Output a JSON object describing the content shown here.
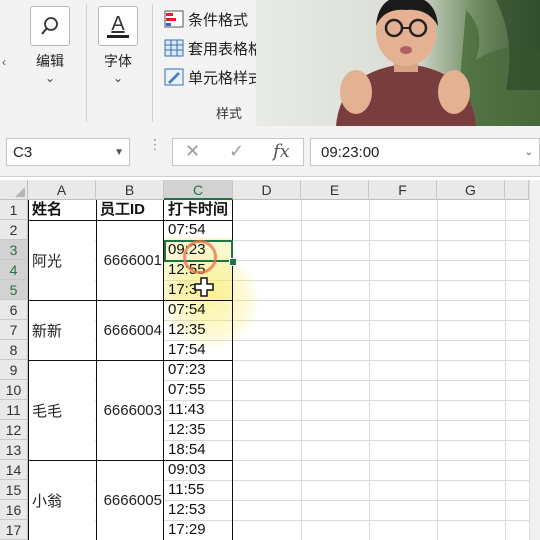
{
  "ribbon": {
    "buttons": [
      {
        "label": "编辑",
        "icon": "search-icon"
      },
      {
        "label": "字体",
        "icon": "font-color-icon"
      }
    ],
    "styles": {
      "items": [
        {
          "label": "条件格式",
          "icon": "conditional-format-icon"
        },
        {
          "label": "套用表格格式",
          "icon": "format-as-table-icon"
        },
        {
          "label": "单元格样式",
          "icon": "cell-styles-icon"
        }
      ],
      "group_label": "样式"
    },
    "font_icon_glyph": "A"
  },
  "formula_bar": {
    "name_box": "C3",
    "cancel_glyph": "✕",
    "enter_glyph": "✓",
    "fx_glyph": "fx",
    "content": "09:23:00"
  },
  "sheet": {
    "columns": [
      "A",
      "B",
      "C",
      "D",
      "E",
      "F",
      "G"
    ],
    "selected_column": "C",
    "rows": [
      "1",
      "2",
      "3",
      "4",
      "5",
      "6",
      "7",
      "8",
      "9",
      "10",
      "11",
      "12",
      "13",
      "14",
      "15",
      "16",
      "17"
    ],
    "selected_rows": [
      "3",
      "4",
      "5"
    ],
    "headers": {
      "name": "姓名",
      "id": "员工ID",
      "time": "打卡时间"
    },
    "employees": [
      {
        "name": "阿光",
        "id": "6666001"
      },
      {
        "name": "新新",
        "id": "6666004"
      },
      {
        "name": "毛毛",
        "id": "6666003"
      },
      {
        "name": "小翁",
        "id": "6666005"
      }
    ],
    "times": [
      "07:54",
      "09:23",
      "12:55",
      "17:3",
      "07:54",
      "12:35",
      "17:54",
      "07:23",
      "07:55",
      "11:43",
      "12:35",
      "18:54",
      "09:03",
      "11:55",
      "12:53",
      "17:29"
    ],
    "active_cell": "C3"
  },
  "colors": {
    "accent": "#217346",
    "highlight": "#eeec78"
  }
}
